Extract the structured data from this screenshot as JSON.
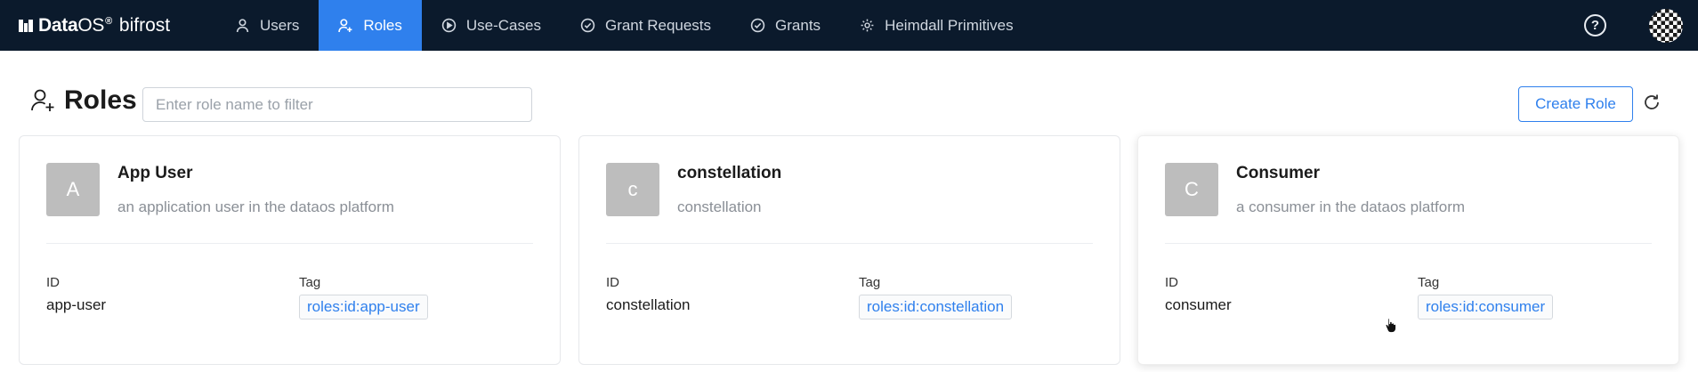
{
  "nav": {
    "brand": {
      "name_bold": "Data",
      "name_os": "OS",
      "reg": "®",
      "app": "bifrost"
    },
    "items": [
      {
        "label": "Users",
        "icon": "user-icon"
      },
      {
        "label": "Roles",
        "icon": "roles-icon",
        "active": true
      },
      {
        "label": "Use-Cases",
        "icon": "play-circle-icon"
      },
      {
        "label": "Grant Requests",
        "icon": "check-circle-icon"
      },
      {
        "label": "Grants",
        "icon": "check-circle-icon"
      },
      {
        "label": "Heimdall Primitives",
        "icon": "gear-icon"
      }
    ],
    "help_label": "?"
  },
  "page": {
    "title": "Roles",
    "filter_placeholder": "Enter role name to filter",
    "create_label": "Create Role"
  },
  "field_labels": {
    "id": "ID",
    "tag": "Tag"
  },
  "roles": [
    {
      "initial": "A",
      "name": "App User",
      "description": "an application user in the dataos platform",
      "id": "app-user",
      "tag": "roles:id:app-user"
    },
    {
      "initial": "c",
      "name": "constellation",
      "description": "constellation",
      "id": "constellation",
      "tag": "roles:id:constellation"
    },
    {
      "initial": "C",
      "name": "Consumer",
      "description": "a consumer in the dataos platform",
      "id": "consumer",
      "tag": "roles:id:consumer"
    }
  ],
  "colors": {
    "nav_bg": "#0b1a2c",
    "accent": "#2f80ed",
    "avatar_bg": "#bdbdbd"
  }
}
